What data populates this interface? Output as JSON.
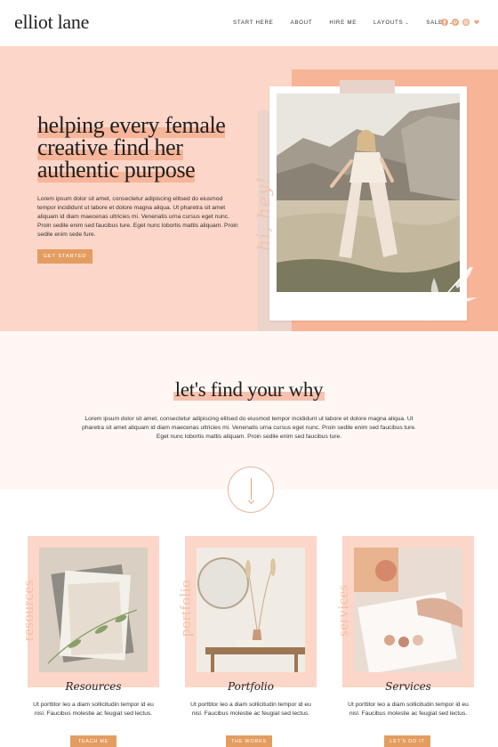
{
  "header": {
    "logo": "elliot lane",
    "nav": [
      "START HERE",
      "ABOUT",
      "HIRE ME",
      "LAYOUTS",
      "SALES"
    ],
    "socials": [
      "facebook-icon",
      "pinterest-icon",
      "instagram-icon",
      "heart-icon"
    ]
  },
  "hero": {
    "title_lines": [
      "helping every female",
      "creative find her",
      "authentic purpose"
    ],
    "body": "Lorem ipsum dolor sit amet, consectetur adipiscing elitsed do eiusmod tempor incididunt ut labore et dolore magna aliqua. Ut pharetra sit amet aliquam id diam maecenas ultricies mi. Venenatis urna cursus eget nunc. Proin sedile enim sed faucibus ture. Eget nunc lobortis mattis aliquam. Proin sedile enim sede fure.",
    "button": "GET STARTED",
    "script_text": "hi, hey!"
  },
  "why": {
    "title": "let's find your why",
    "body": "Lorem ipsum dolor sit amet, consectetur adipiscing elitsed do eiusmod tempor incididunt ut labore et dolore magna aliqua. Ut pharetra sit amet aliquam id diam maecenas ultricies mi. Venenatis urna cursus eget nunc. Proin sedile enim sed faucibus ture. Eget nunc lobortis mattis aliquam. Proin sedile enim sed faucibus ture."
  },
  "cards": [
    {
      "vertical": "resources",
      "name": "Resources",
      "text": "Ut porttitor leo a diam sollicitudin tempor id eu nisl. Faucibus molestie ac feugiat sed lectus.",
      "button": "TEACH ME"
    },
    {
      "vertical": "portfolio",
      "name": "Portfolio",
      "text": "Ut porttitor leo a diam sollicitudin tempor id eu nisl. Faucibus molestie ac feugiat sed lectus.",
      "button": "THE WORKS"
    },
    {
      "vertical": "services",
      "name": "Services",
      "text": "Ut porttitor leo a diam sollicitudin tempor id eu nisl. Faucibus molestie ac feugiat sed lectus.",
      "button": "LET'S DO IT"
    }
  ],
  "colors": {
    "accent": "#e39d60",
    "blush": "#fcd6c8",
    "peach": "#f8b497"
  }
}
